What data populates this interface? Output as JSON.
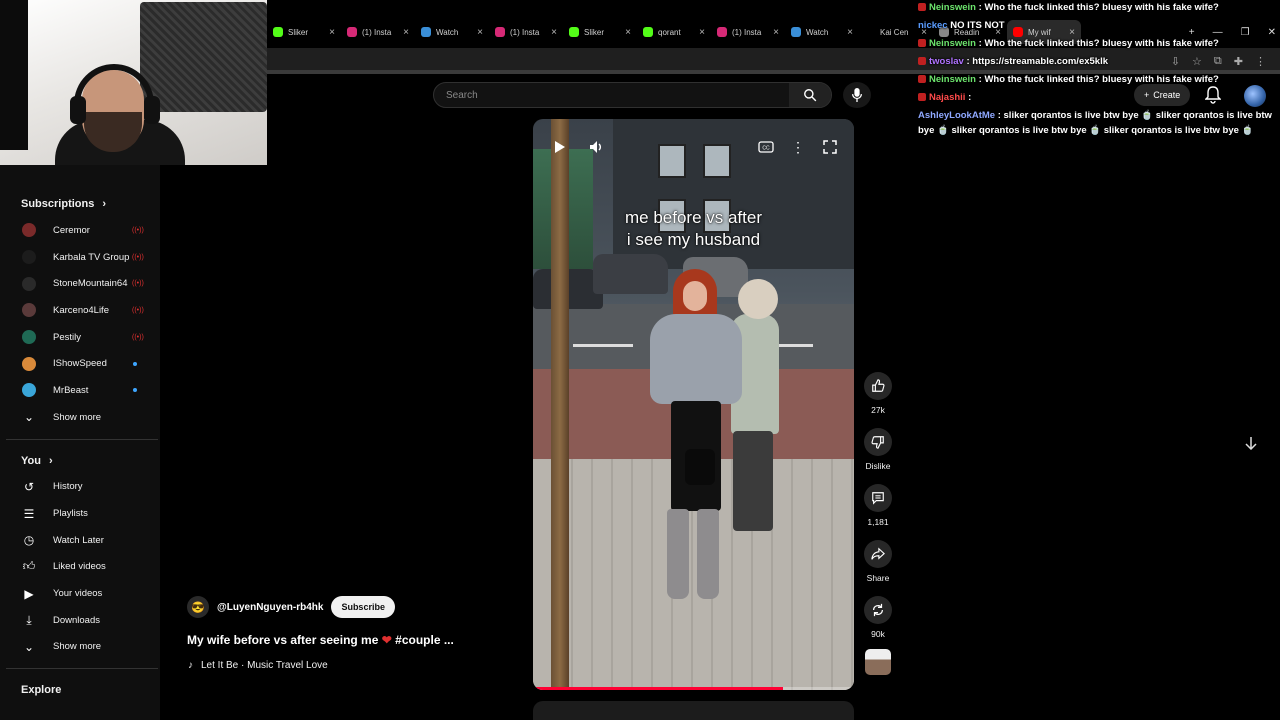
{
  "browser": {
    "tabs": [
      {
        "title": "Sliker",
        "fav": "kick",
        "color": "#53fc18"
      },
      {
        "title": "(1) Insta",
        "fav": "instagram",
        "color": "#d62976"
      },
      {
        "title": "Watch",
        "fav": "watch",
        "color": "#3a8fd8"
      },
      {
        "title": "(1) Insta",
        "fav": "instagram",
        "color": "#d62976"
      },
      {
        "title": "Sliker",
        "fav": "kick",
        "color": "#53fc18"
      },
      {
        "title": "qorant",
        "fav": "kick",
        "color": "#53fc18"
      },
      {
        "title": "(1) Insta",
        "fav": "instagram",
        "color": "#d62976"
      },
      {
        "title": "Watch",
        "fav": "watch",
        "color": "#3a8fd8"
      },
      {
        "title": "Kai Cen",
        "fav": "x",
        "color": "#000000"
      },
      {
        "title": "Readin",
        "fav": "doc",
        "color": "#888888"
      },
      {
        "title": "My wif",
        "fav": "youtube",
        "color": "#ff0000"
      }
    ]
  },
  "search": {
    "placeholder": "Search"
  },
  "header": {
    "create_label": "Create"
  },
  "sidebar": {
    "subscriptions_title": "Subscriptions",
    "subscriptions": [
      {
        "name": "Ceremor",
        "status": "live",
        "color": "#7a2a2a"
      },
      {
        "name": "Karbala TV Group",
        "status": "live",
        "color": "#1c1c1c"
      },
      {
        "name": "StoneMountain64",
        "status": "live",
        "color": "#2a2a2a"
      },
      {
        "name": "Karceno4Life",
        "status": "live",
        "color": "#5a3a3a"
      },
      {
        "name": "Pestily",
        "status": "live",
        "color": "#1f6a55"
      },
      {
        "name": "IShowSpeed",
        "status": "new",
        "color": "#d98a3a"
      },
      {
        "name": "MrBeast",
        "status": "new",
        "color": "#3aa6d9"
      }
    ],
    "subs_show_more": "Show more",
    "you_title": "You",
    "you_items": [
      {
        "label": "History",
        "icon": "history-icon"
      },
      {
        "label": "Playlists",
        "icon": "playlists-icon"
      },
      {
        "label": "Watch Later",
        "icon": "clock-icon"
      },
      {
        "label": "Liked videos",
        "icon": "like-icon"
      },
      {
        "label": "Your videos",
        "icon": "your-videos-icon"
      },
      {
        "label": "Downloads",
        "icon": "download-icon"
      }
    ],
    "you_show_more": "Show more",
    "explore_title": "Explore"
  },
  "video": {
    "caption_line1": "me before vs after",
    "caption_line2": "i see my husband",
    "progress": 0.78
  },
  "actions": {
    "likes": "27k",
    "dislike_label": "Dislike",
    "comments": "1,181",
    "share_label": "Share",
    "remix_count": "90k"
  },
  "info": {
    "channel": "@LuyenNguyen-rb4hk",
    "subscribe_label": "Subscribe",
    "title_pre": "My wife before vs after seeing me",
    "title_post": " #couple ...",
    "music": "Let It Be · Music Travel Love"
  },
  "chat": [
    {
      "user": "Neinswein",
      "color": "#6ce36c",
      "msg": " : Who the fuck linked this? bluesy with his fake wife?",
      "badge": "#c02020"
    },
    {
      "user": "nickec",
      "color": "#5a9cff",
      "msg": " NO ITS NOT",
      "badge": ""
    },
    {
      "user": "Neinswein",
      "color": "#6ce36c",
      "msg": " : Who the fuck linked this? bluesy with his fake wife?",
      "badge": "#c02020"
    },
    {
      "user": "twoslav",
      "color": "#b073ff",
      "msg": " : https://streamable.com/ex5klk",
      "badge": "#c02020"
    },
    {
      "user": "Neinswein",
      "color": "#6ce36c",
      "msg": " : Who the fuck linked this? bluesy with his fake wife?",
      "badge": "#c02020"
    },
    {
      "user": "Najashii",
      "color": "#ff4a4a",
      "msg": " :",
      "badge": "#c02020"
    },
    {
      "user": "AshleyLookAtMe",
      "color": "#8fa8ff",
      "msg": " : sliker qorantos is live btw bye 🍵 sliker qorantos is live btw bye 🍵 sliker qorantos is live btw bye 🍵 sliker qorantos is live btw bye 🍵",
      "badge": ""
    }
  ]
}
